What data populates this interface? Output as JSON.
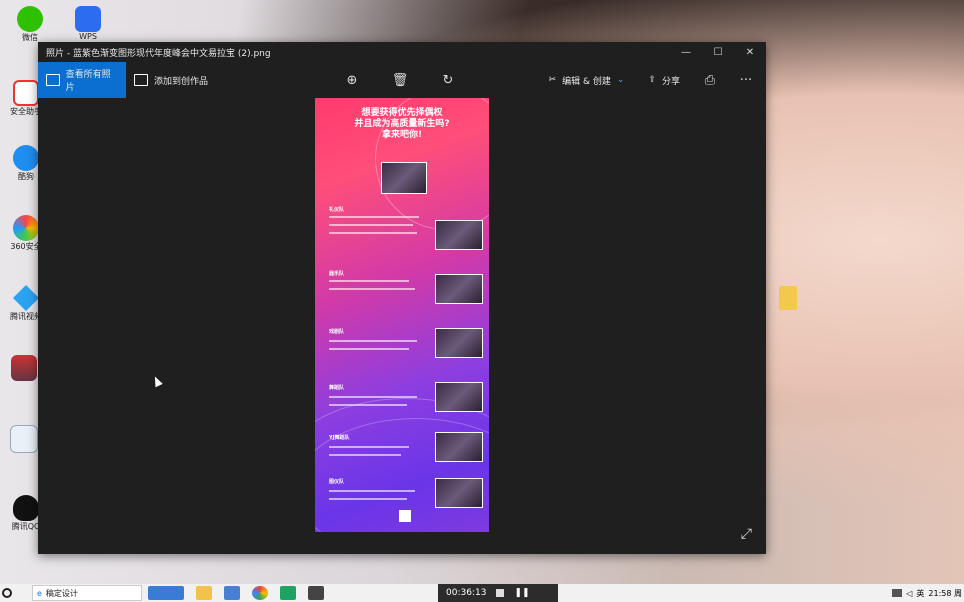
{
  "window": {
    "title": "照片 - 蓝紫色渐变图形现代年度峰会中文易拉宝 (2).png",
    "controls": {
      "minimize": "—",
      "maximize": "☐",
      "close": "✕"
    }
  },
  "toolbar": {
    "view_all_label": "查看所有照片",
    "add_to_creation_label": "添加到创作品",
    "edit_create_label": "编辑 & 创建",
    "share_label": "分享",
    "more_label": "···"
  },
  "poster": {
    "title_line1": "想要获得优先择偶权",
    "title_line2": "并且成为高质量新生吗?",
    "title_line3": "拿来吧你!",
    "sections": [
      "礼仪队",
      "器乐队",
      "戏剧队",
      "舞蹈队",
      "YJ舞蹈队",
      "图仪队"
    ]
  },
  "desktop": {
    "icons": [
      "微信",
      "WPS",
      "安全助手",
      "酷狗",
      "360安全",
      "腾讯视频",
      "",
      "",
      "腾讯QQ"
    ]
  },
  "taskbar": {
    "search_placeholder": "稿定设计",
    "timer": "00:36:13",
    "ime": "英",
    "clock": "21:58 周"
  },
  "colors": {
    "accent": "#0a6fd1",
    "window_bg": "#1f1f1f",
    "taskbar_bg": "#f1f1f1"
  }
}
